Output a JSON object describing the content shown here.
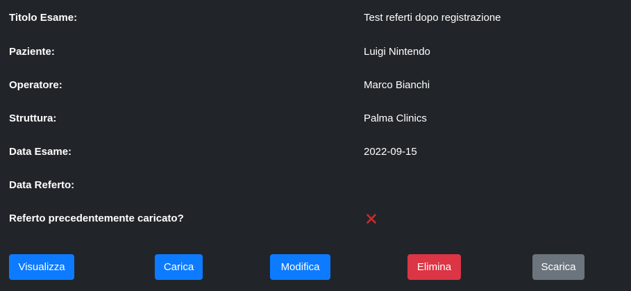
{
  "details": {
    "rows": [
      {
        "label": "Titolo Esame:",
        "value": "Test referti dopo registrazione"
      },
      {
        "label": "Paziente:",
        "value": "Luigi Nintendo"
      },
      {
        "label": "Operatore:",
        "value": "Marco Bianchi"
      },
      {
        "label": "Struttura:",
        "value": "Palma Clinics"
      },
      {
        "label": "Data Esame:",
        "value": "2022-09-15"
      },
      {
        "label": "Data Referto:",
        "value": ""
      },
      {
        "label": "Referto precedentemente caricato?",
        "icon": "cross-mark-icon",
        "icon_color": "#e03131"
      }
    ]
  },
  "actions": {
    "view_label": "Visualizza",
    "upload_label": "Carica",
    "edit_label": "Modifica",
    "delete_label": "Elimina",
    "download_label": "Scarica"
  },
  "colors": {
    "background": "#212529",
    "primary": "#0d7bff",
    "danger": "#dc3545",
    "secondary": "#6c757d"
  }
}
